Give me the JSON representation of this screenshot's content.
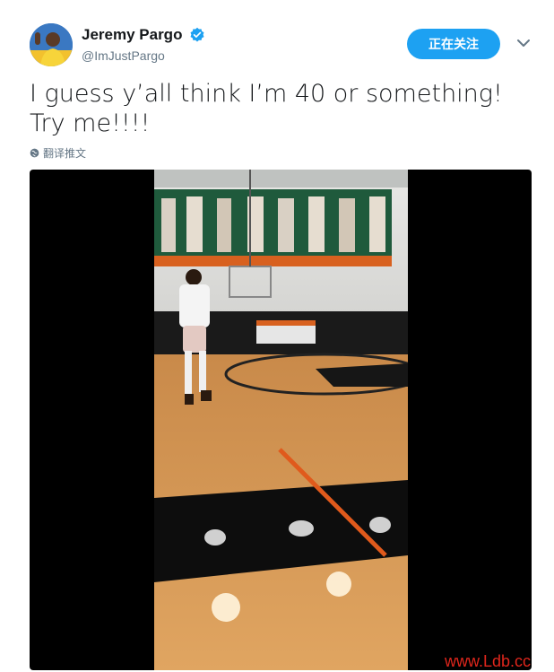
{
  "user": {
    "name": "Jeremy Pargo",
    "handle": "@ImJustPargo",
    "verified": true,
    "avatar_icon": "user-avatar"
  },
  "follow_button": {
    "label": "正在关注",
    "color": "#1da1f2"
  },
  "menu_icon": "chevron-down-icon",
  "tweet": {
    "text": "I guess y’all think I’m 40 or something! Try me!!!!"
  },
  "translate": {
    "label": "翻译推文",
    "icon": "globe-icon"
  },
  "media": {
    "type": "video",
    "description_icon": "basketball-court-video"
  },
  "watermark": {
    "text": "www.Ldb.cc",
    "color": "#e0261c"
  }
}
